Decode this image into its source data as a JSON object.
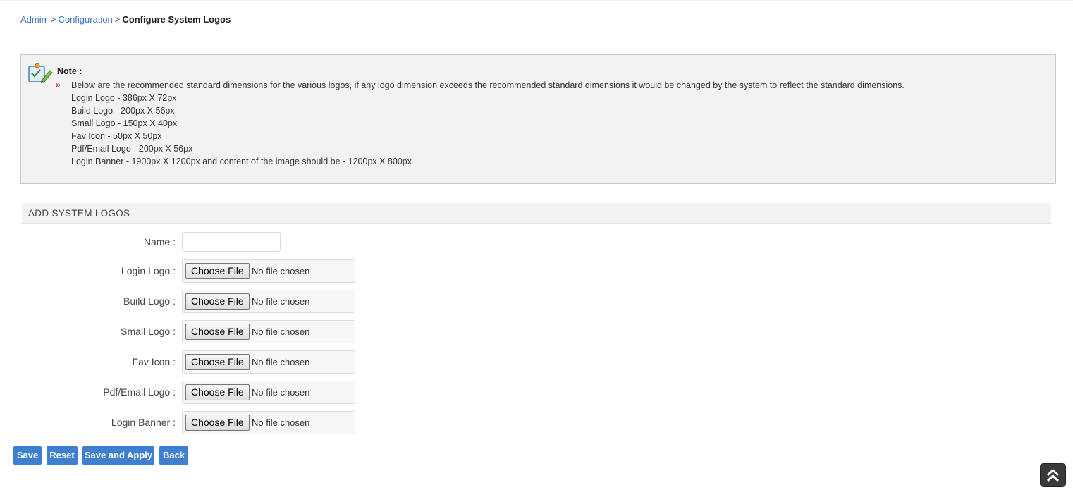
{
  "breadcrumb": {
    "admin": "Admin",
    "configuration": "Configuration",
    "current": "Configure System Logos",
    "separator": ">"
  },
  "note": {
    "icon": "checklist-pencil-icon",
    "title": "Note :",
    "bullet": "»",
    "lines": [
      "Below are the recommended standard dimensions for the various logos, if any logo dimension exceeds the recommended standard dimensions it would be changed by the system to reflect the standard dimensions.",
      "Login Logo - 386px X 72px",
      "Build Logo - 200px X 56px",
      "Small Logo - 150px X 40px",
      "Fav Icon - 50px X 50px",
      "Pdf/Email Logo - 200px X 56px",
      "Login Banner - 1900px X 1200px and content of the image should be - 1200px X 800px"
    ]
  },
  "form": {
    "section_title": "ADD SYSTEM LOGOS",
    "name_label": "Name :",
    "name_value": "",
    "choose_label": "Choose File",
    "no_file": "No file chosen",
    "fields": [
      {
        "label": "Login Logo :"
      },
      {
        "label": "Build Logo :"
      },
      {
        "label": "Small Logo :"
      },
      {
        "label": "Fav Icon :"
      },
      {
        "label": "Pdf/Email Logo :"
      },
      {
        "label": "Login Banner :"
      }
    ]
  },
  "buttons": {
    "save": "Save",
    "reset": "Reset",
    "save_apply": "Save and Apply",
    "back": "Back"
  },
  "colors": {
    "link": "#3b73b9",
    "button": "#3f7fd0",
    "note_bg": "#f2f2f2"
  }
}
